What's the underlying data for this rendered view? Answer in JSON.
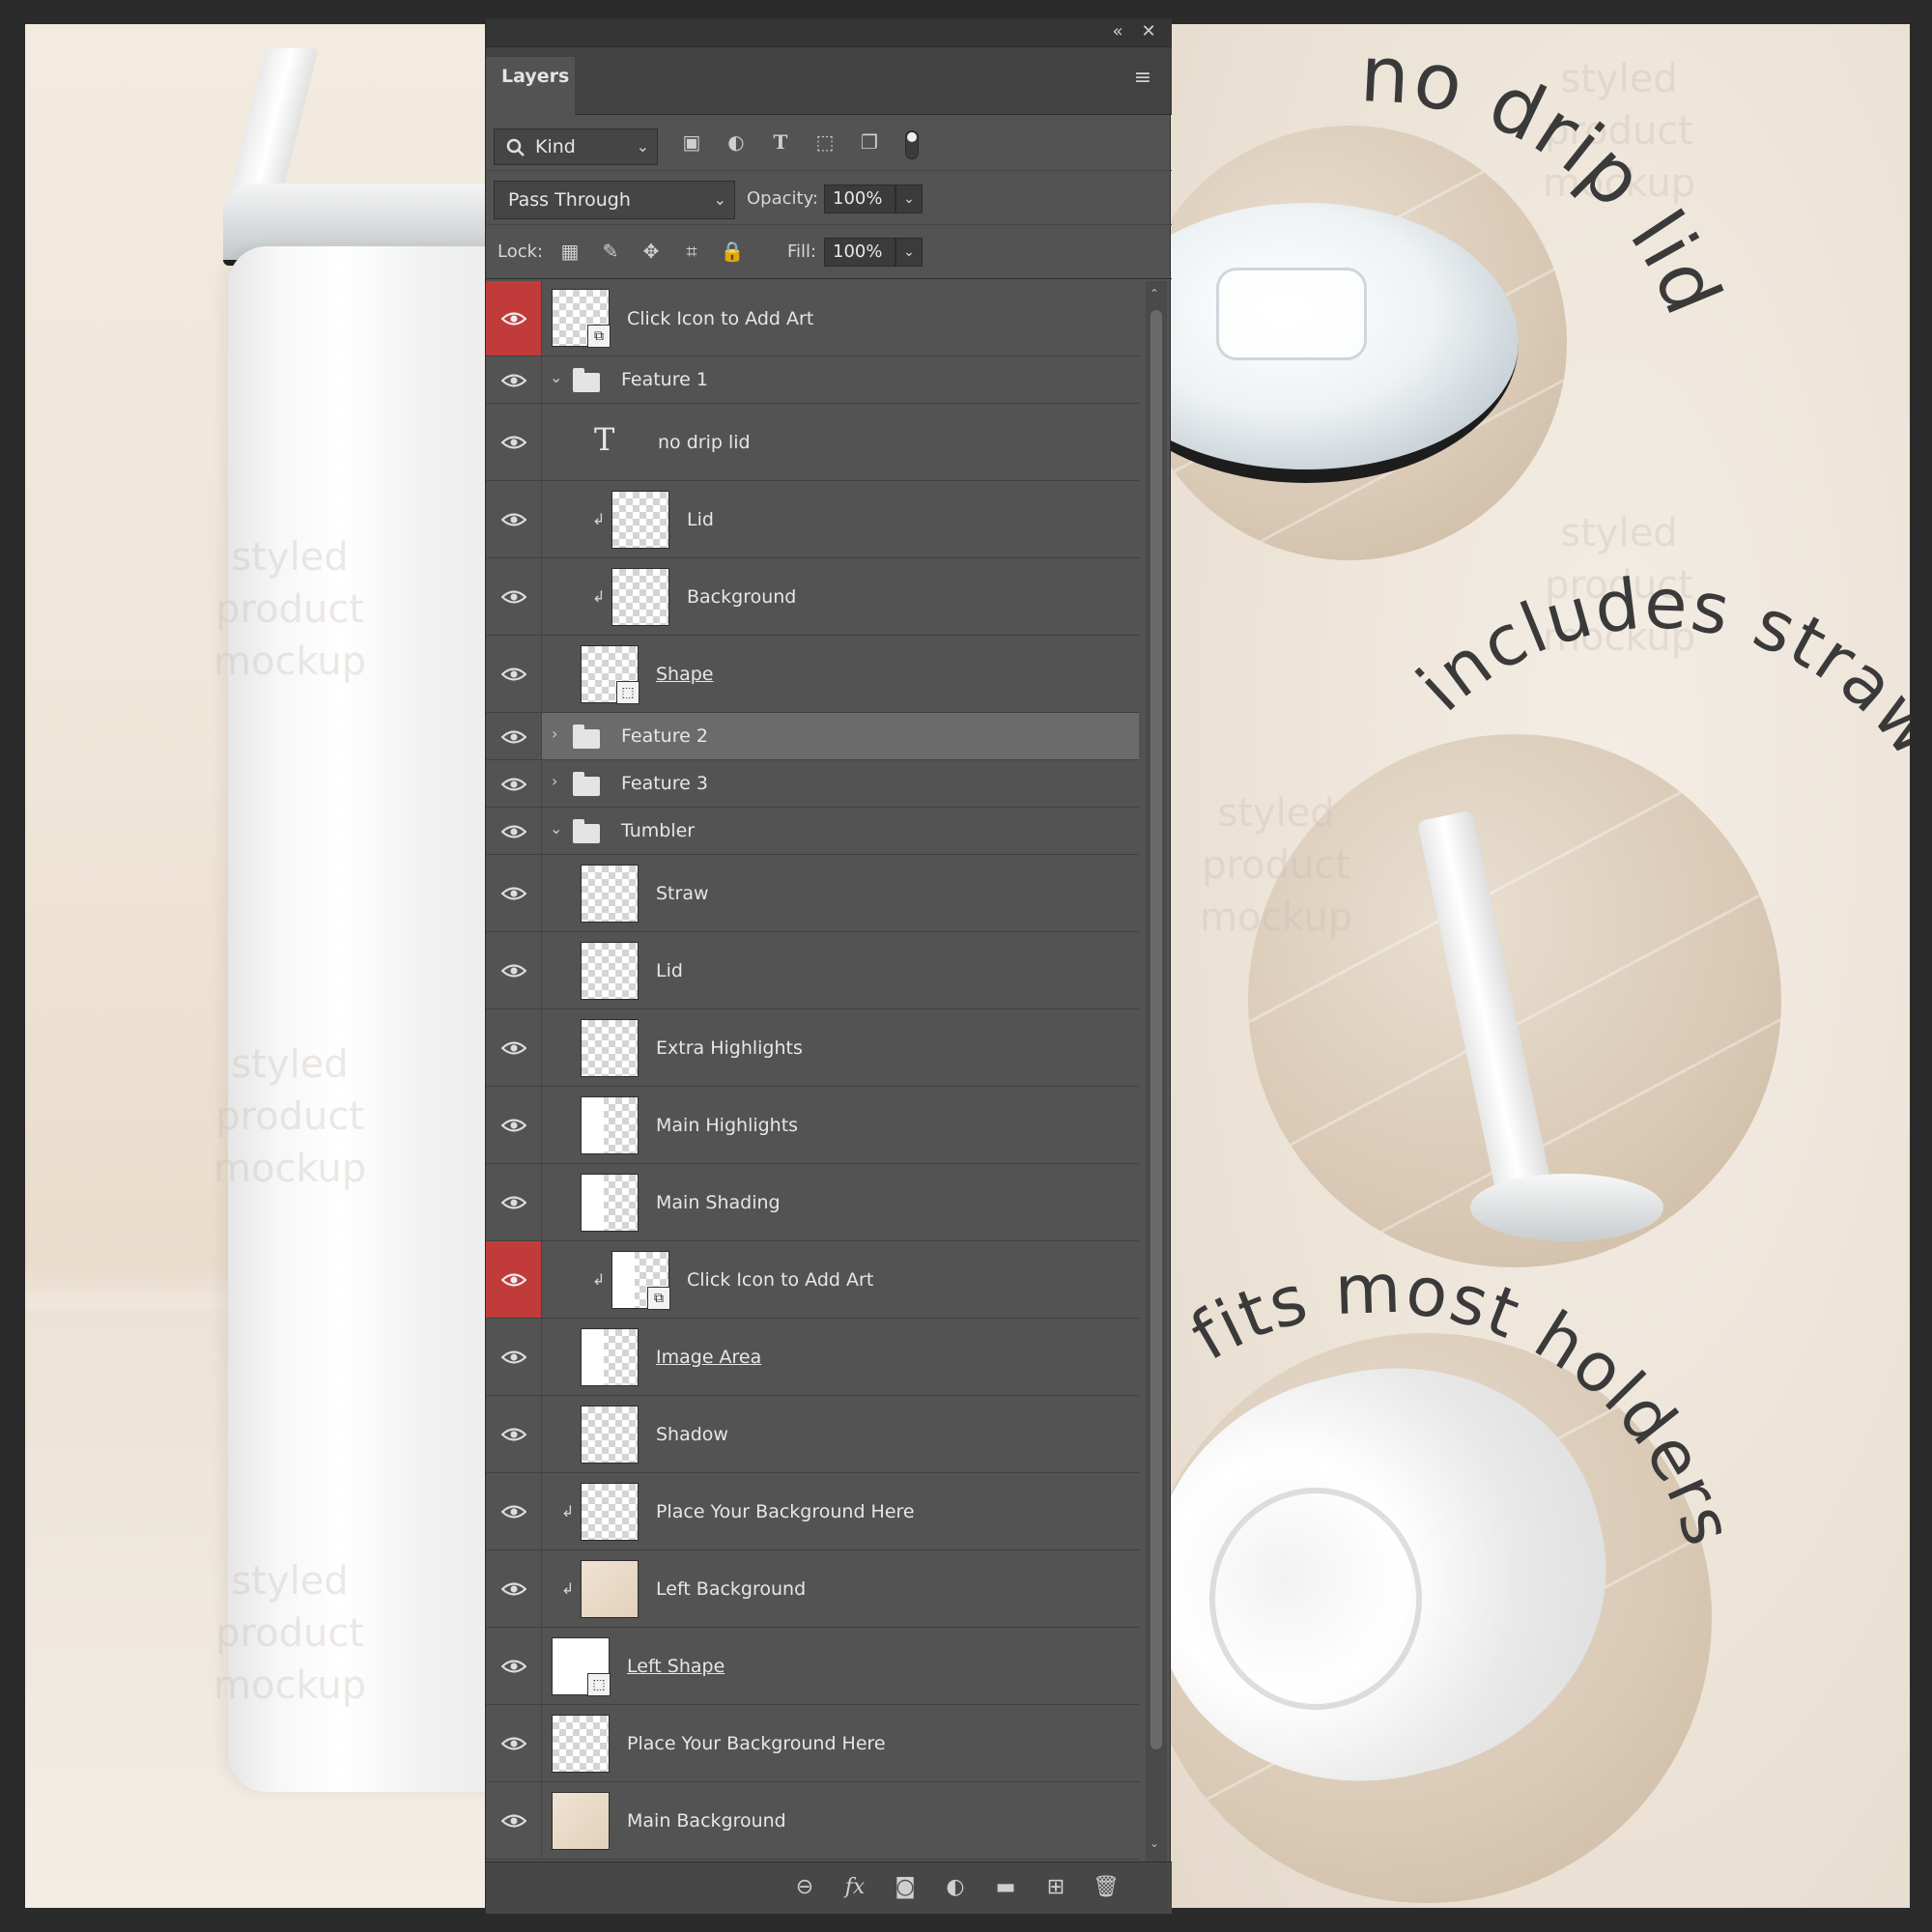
{
  "panel": {
    "tab_label": "Layers",
    "filter": {
      "label": "Kind"
    },
    "blend_mode": "Pass Through",
    "opacity_label": "Opacity:",
    "opacity_value": "100%",
    "lock_label": "Lock:",
    "fill_label": "Fill:",
    "fill_value": "100%"
  },
  "layers": [
    {
      "name": "Click Icon to Add Art"
    },
    {
      "name": "Feature 1"
    },
    {
      "name": "no drip lid"
    },
    {
      "name": "Lid"
    },
    {
      "name": "Background"
    },
    {
      "name": "Shape"
    },
    {
      "name": "Feature 2"
    },
    {
      "name": "Feature 3"
    },
    {
      "name": "Tumbler"
    },
    {
      "name": "Straw"
    },
    {
      "name": "Lid"
    },
    {
      "name": "Extra Highlights"
    },
    {
      "name": "Main Highlights"
    },
    {
      "name": "Main Shading"
    },
    {
      "name": "Click Icon to Add Art"
    },
    {
      "name": "Image Area"
    },
    {
      "name": "Shadow"
    },
    {
      "name": "Place Your Background Here"
    },
    {
      "name": "Left Background"
    },
    {
      "name": "Left Shape"
    },
    {
      "name": "Place Your Background Here"
    },
    {
      "name": "Main Background"
    }
  ],
  "canvas": {
    "feature_1_text": "no drip lid",
    "feature_2_text": "includes straw",
    "feature_3_text": "fits most holders",
    "watermark": [
      "styled",
      "product",
      "mockup"
    ]
  },
  "colors": {
    "panel_bg": "#535353",
    "visibility_highlight": "#c23b3b",
    "selected_row": "#6b6b6b"
  },
  "icons": {
    "bottom_bar": [
      "link-layers-icon",
      "fx-icon",
      "add-mask-icon",
      "adjustment-layer-icon",
      "new-group-icon",
      "new-layer-icon",
      "trash-icon"
    ],
    "filter_bar": [
      "pixel-filter-icon",
      "adjustment-filter-icon",
      "type-filter-icon",
      "shape-filter-icon",
      "smart-object-filter-icon",
      "filter-toggle-icon"
    ],
    "lock_bar": [
      "lock-transparent-icon",
      "lock-paint-icon",
      "lock-position-icon",
      "lock-artboard-icon",
      "lock-all-icon"
    ]
  }
}
